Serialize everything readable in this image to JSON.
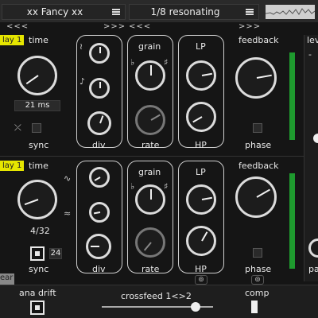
{
  "topbar": {
    "preset_name": "xx Fancy xx",
    "mode_name": "1/8 resonating",
    "prev_arrows": "<<<",
    "next_arrows": ">>>"
  },
  "lanes": [
    {
      "delay_badge": "lay 1",
      "time_label": "time",
      "time_value": "21 ms",
      "sync_label": "sync",
      "div_label": "div",
      "grain_label": "grain",
      "rate_label": "rate",
      "lp_label": "LP",
      "hp_label": "HP",
      "feedback_label": "feedback",
      "phase_label": "phase",
      "grain_flat": "♭",
      "grain_sharp": "♯"
    },
    {
      "delay_badge": "lay 1",
      "time_label": "time",
      "time_value": "4/32",
      "sync_label": "sync",
      "sync_count": "24",
      "div_label": "div",
      "grain_label": "grain",
      "rate_label": "rate",
      "lp_label": "LP",
      "hp_label": "HP",
      "feedback_label": "feedback",
      "phase_label": "phase",
      "grain_flat": "♭",
      "grain_sharp": "♯"
    }
  ],
  "right_strip": {
    "level_label": "lev",
    "minus": "-",
    "pan_label": "pa"
  },
  "bottom": {
    "clear_label": "ear",
    "ana_drift_label": "ana drift",
    "crossfeed_label": "crossfeed 1<>2",
    "comp_label": "comp",
    "crossfeed_value": 0.84
  },
  "colors": {
    "accent_green": "#1e9a2e",
    "badge_yellow": "#e6e600",
    "stroke": "#dcdcdc"
  }
}
